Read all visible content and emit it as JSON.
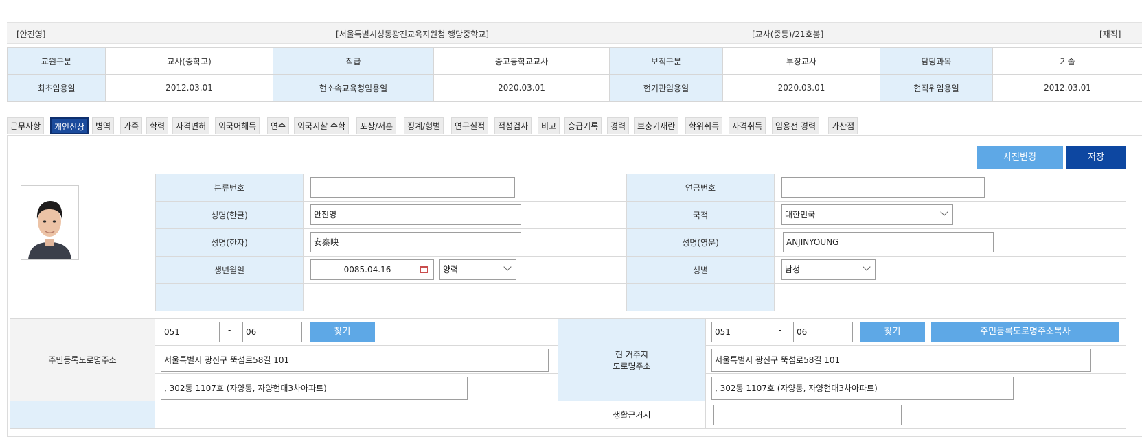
{
  "summary": {
    "name": "[안진영]",
    "office": "[서울특별시성동광진교육지원청 행당중학교]",
    "position": "[교사(중등)/21호봉]",
    "status": "[재직]"
  },
  "info": {
    "row1": [
      {
        "label": "교원구분",
        "value": "교사(중학교)"
      },
      {
        "label": "직급",
        "value": "중고등학교교사"
      },
      {
        "label": "보직구분",
        "value": "부장교사"
      },
      {
        "label": "담당과목",
        "value": "기술"
      }
    ],
    "row2": [
      {
        "label": "최초임용일",
        "value": "2012.03.01"
      },
      {
        "label": "현소속교육청임용일",
        "value": "2020.03.01"
      },
      {
        "label": "현기관임용일",
        "value": "2020.03.01"
      },
      {
        "label": "현직위임용일",
        "value": "2012.03.01"
      }
    ]
  },
  "tabs": [
    "근무사항",
    "개인신상",
    "병역",
    "가족",
    "학력",
    "자격면허",
    "외국어해득",
    "연수",
    "외국시찰 수학",
    "포상/서훈",
    "징계/형벌",
    "연구실적",
    "적성검사",
    "비고",
    "승급기록",
    "경력",
    "보충기재란",
    "학위취득",
    "자격취득",
    "임용전 경력",
    "가산점"
  ],
  "active_tab": "개인신상",
  "buttons": {
    "photo_change": "사진변경",
    "save": "저장",
    "find": "찾기",
    "copy_address": "주민등록도로명주소복사"
  },
  "personal": {
    "class_no_label": "분류번호",
    "class_no": "",
    "pension_no_label": "연금번호",
    "pension_no": "",
    "name_kor_label": "성명(한글)",
    "name_kor": "안진영",
    "nationality_label": "국적",
    "nationality": "대한민국",
    "name_hanja_label": "성명(한자)",
    "name_hanja": "安秦映",
    "name_eng_label": "성명(영문)",
    "name_eng": "ANJINYOUNG",
    "birth_label": "생년월일",
    "birth": "0085.04.16",
    "calendar": "양력",
    "gender_label": "성별",
    "gender": "남성"
  },
  "address": {
    "reg_label": "주민등록도로명주소",
    "reg_zip1": "051",
    "reg_zip2": "06",
    "reg_addr1": "서울특별시 광진구 뚝섬로58길 101",
    "reg_addr2": ", 302동 1107호 (자양동, 자양현대3차아파트)",
    "cur_label_1": "현 거주지",
    "cur_label_2": "도로명주소",
    "cur_zip1": "051",
    "cur_zip2": "06",
    "cur_addr1": "서울특별시 광진구 뚝섬로58길 101",
    "cur_addr2": ", 302동 1107호 (자양동, 자양현대3차아파트)",
    "living_label": "생활근거지",
    "living": "",
    "dash": "-"
  },
  "colors": {
    "label_bg": "#e1effa",
    "active_tab": "#1b4b9c",
    "save_button": "#0d47a1",
    "light_button": "#5ea8e6"
  }
}
